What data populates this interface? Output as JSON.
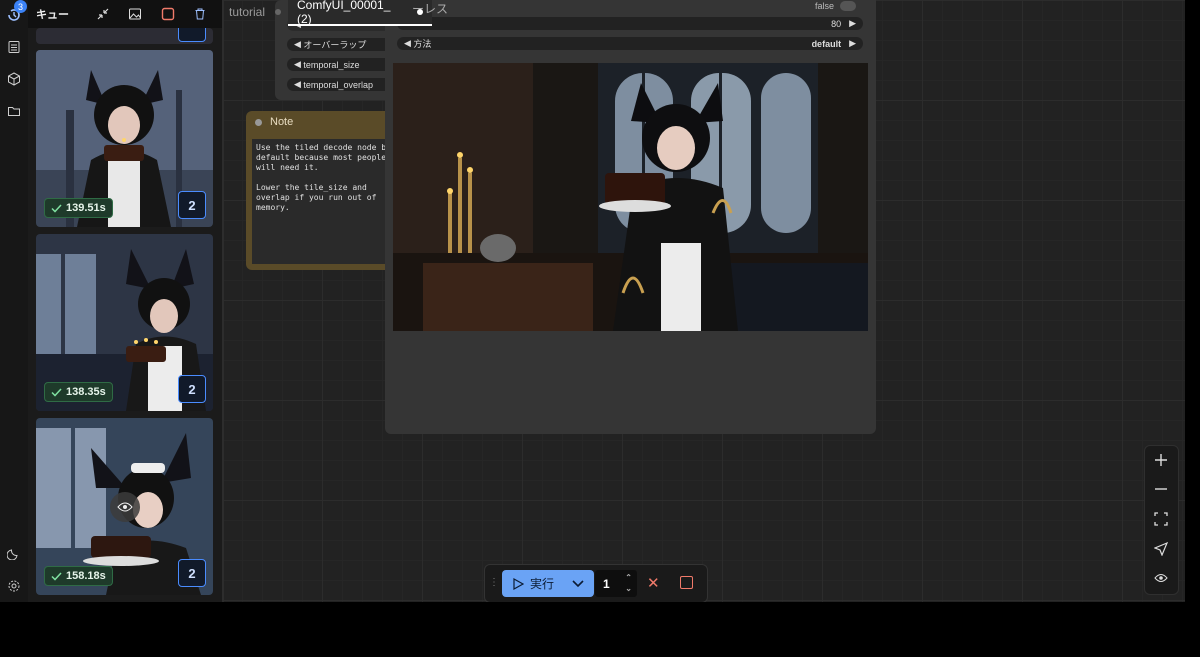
{
  "rail": {
    "queue_badge": "3"
  },
  "queue": {
    "title": "キュー",
    "items": [
      {
        "time": "139.51s",
        "count": "2"
      },
      {
        "time": "138.35s",
        "count": "2"
      },
      {
        "time": "158.18s",
        "count": "2"
      }
    ]
  },
  "tabs": [
    {
      "label": "tutorial"
    },
    {
      "label": "ComfyUI_00001_ (2)"
    }
  ],
  "node_top": {
    "title_partial": "ーレス",
    "widgets": [
      "オーバーラップ",
      "temporal_size",
      "temporal_overlap"
    ]
  },
  "preview_node": {
    "toggle_value": "false",
    "number_value": "80",
    "method_label": "方法",
    "method_value": "default"
  },
  "note": {
    "title": "Note",
    "body": "Use the tiled decode node by default because most people will need it.\n\nLower the tile_size and overlap if you run out of memory."
  },
  "runbar": {
    "run_label": "実行",
    "batch_count": "1"
  },
  "colors": {
    "accent": "#6aa3f5",
    "success": "#2f6b45",
    "note": "#5a4b28"
  },
  "icons": [
    "queue-icon",
    "list-icon",
    "cube-icon",
    "folder-icon",
    "moon-icon",
    "gear-icon",
    "collapse-icon",
    "image-icon",
    "stop-square-icon",
    "trash-icon",
    "eye-icon",
    "plus-icon",
    "minus-icon",
    "fit-view-icon",
    "navigate-icon",
    "play-icon",
    "chevron-down-icon",
    "close-icon"
  ]
}
